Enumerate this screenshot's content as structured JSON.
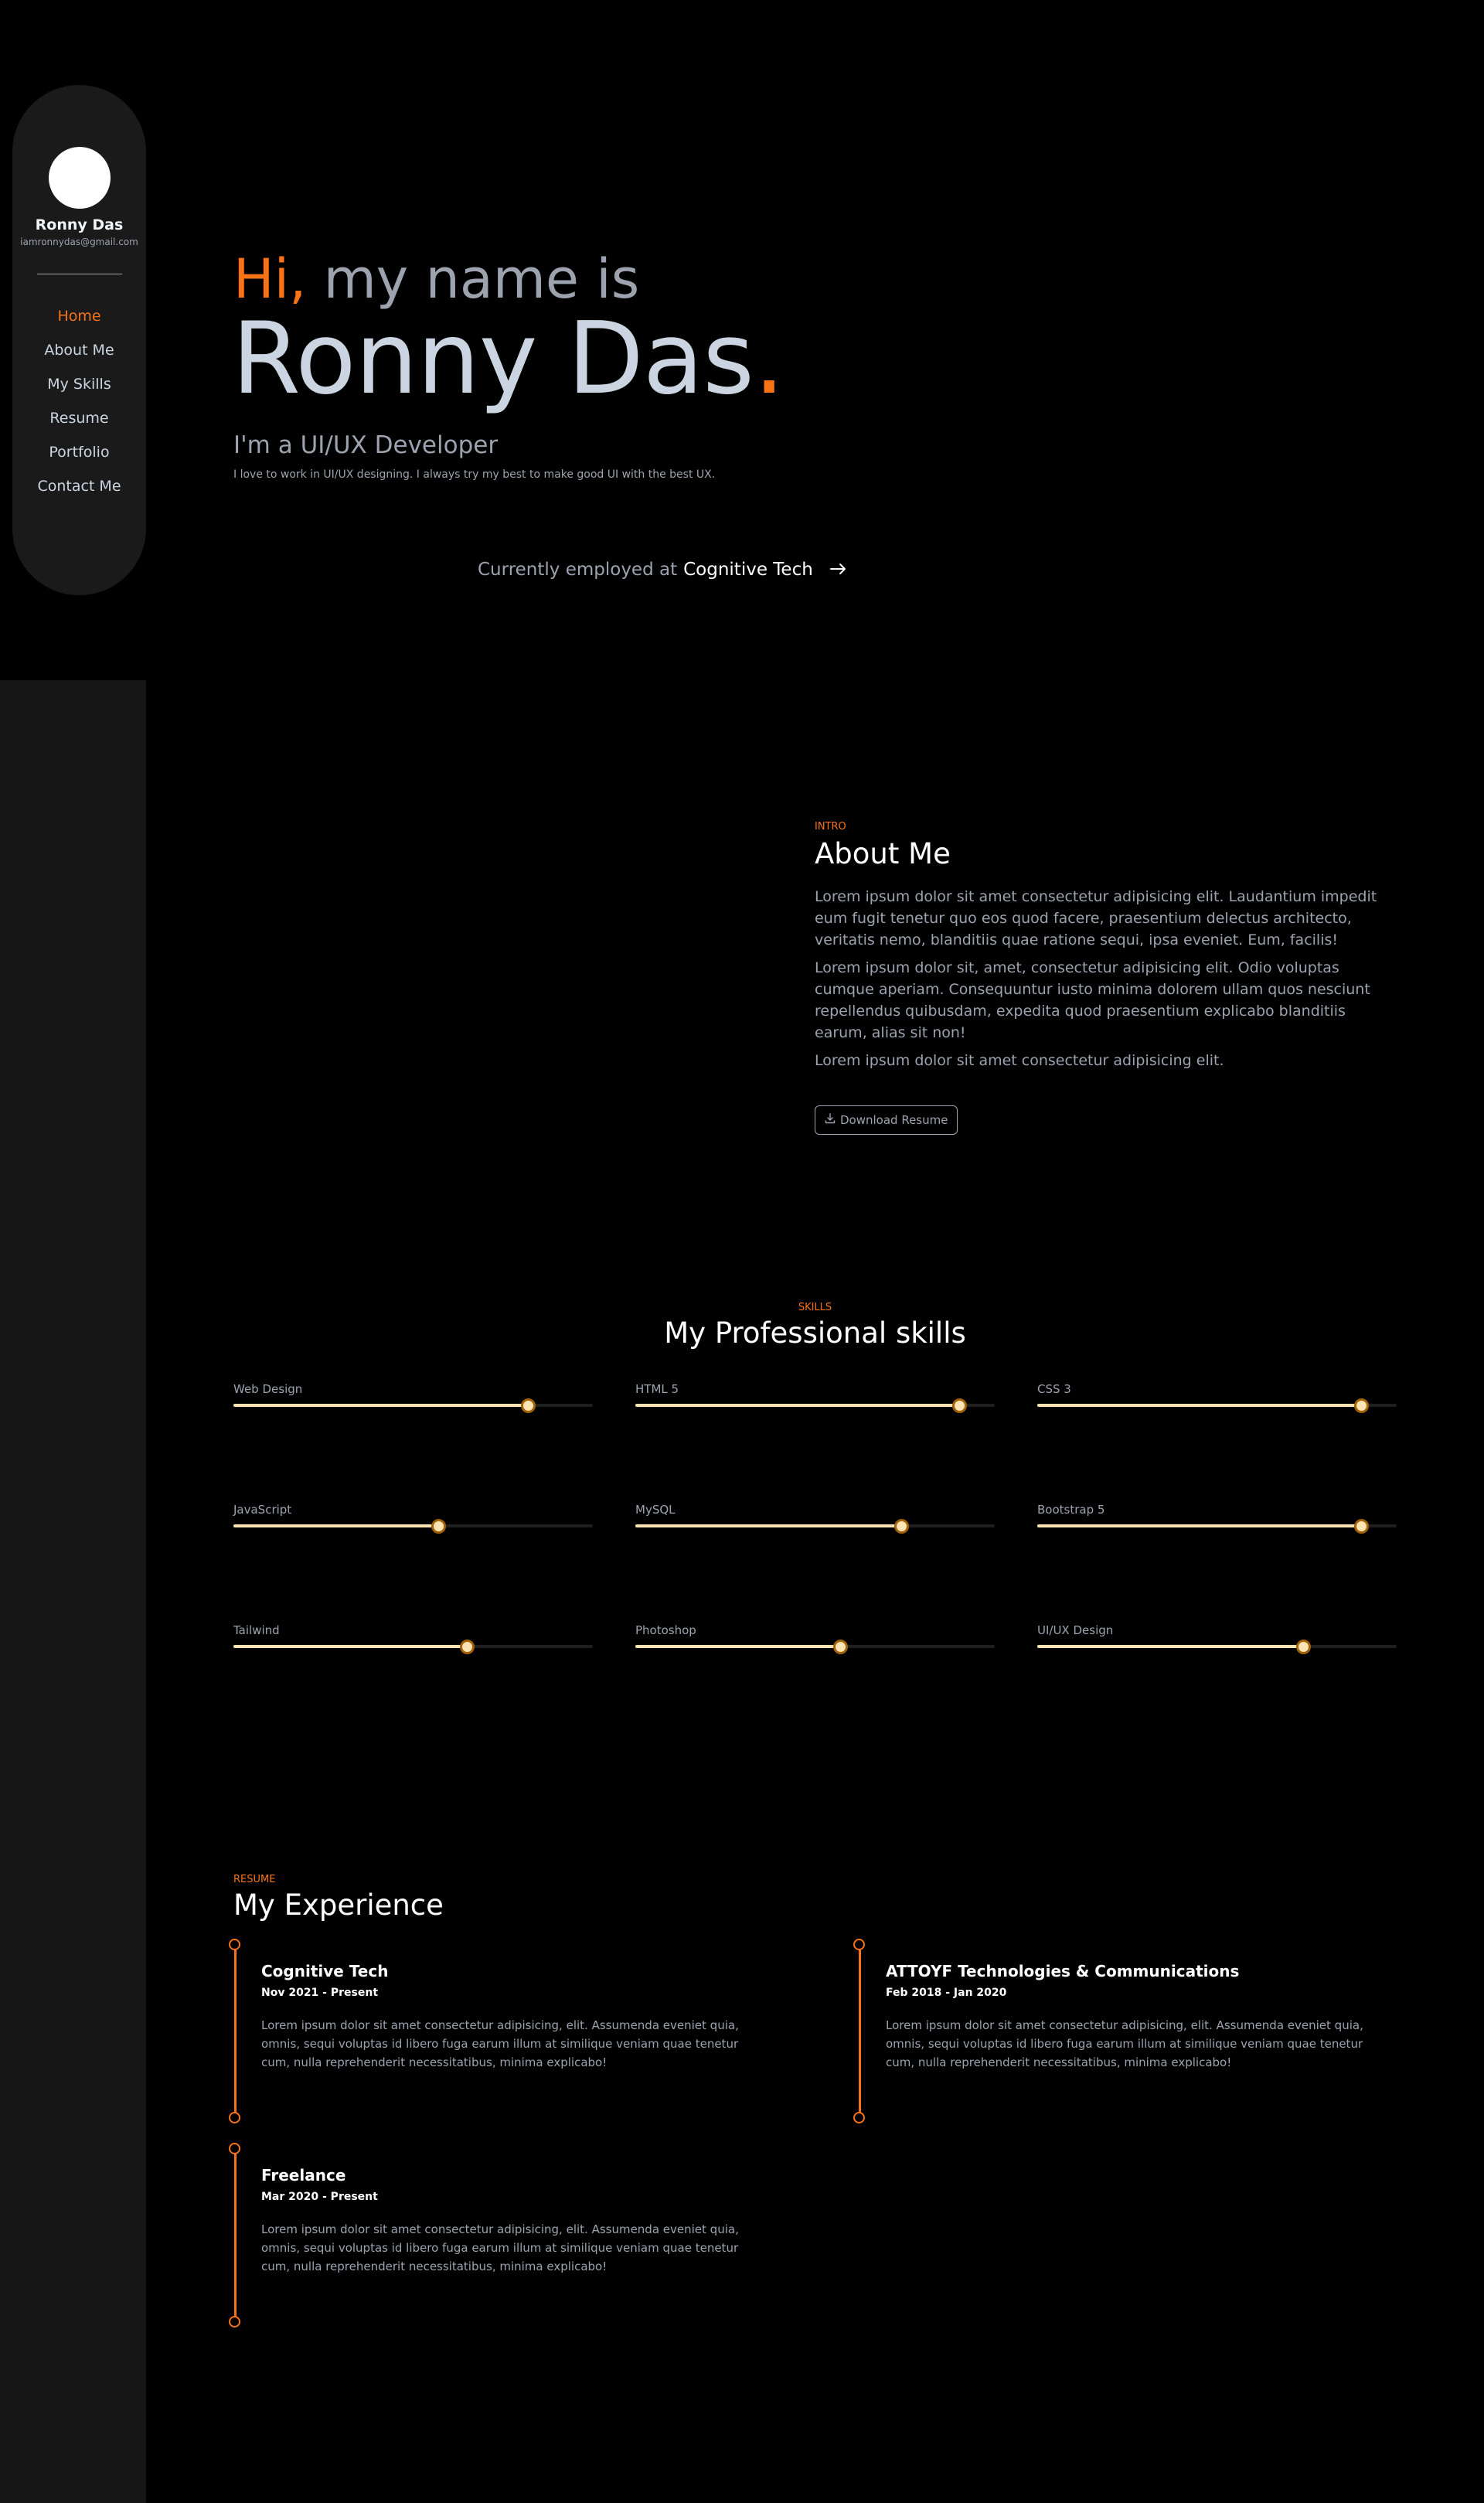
{
  "sidebar": {
    "name": "Ronny Das",
    "email": "iamronnydas@gmail.com",
    "nav": [
      {
        "label": "Home",
        "active": true
      },
      {
        "label": "About Me",
        "active": false
      },
      {
        "label": "My Skills",
        "active": false
      },
      {
        "label": "Resume",
        "active": false
      },
      {
        "label": "Portfolio",
        "active": false
      },
      {
        "label": "Contact Me",
        "active": false
      }
    ]
  },
  "hero": {
    "hi": "Hi,",
    "greeting_rest": "my name is",
    "name": "Ronny Das",
    "name_dot": ".",
    "role": "I'm a UI/UX Developer",
    "description": "I love to work in UI/UX designing. I always try my best to make good UI with the best UX.",
    "employed_prefix": "Currently employed at",
    "employed_company": "Cognitive Tech",
    "arrow_icon": "arrow-right-icon"
  },
  "about": {
    "tag": "INTRO",
    "title": "About Me",
    "paragraphs": [
      "Lorem ipsum dolor sit amet consectetur adipisicing elit. Laudantium impedit eum fugit tenetur quo eos quod facere, praesentium delectus architecto, veritatis nemo, blanditiis quae ratione sequi, ipsa eveniet. Eum, facilis!",
      "Lorem ipsum dolor sit, amet, consectetur adipisicing elit. Odio voluptas cumque aperiam. Consequuntur iusto minima dolorem ullam quos nesciunt repellendus quibusdam, expedita quod praesentium explicabo blanditiis earum, alias sit non!",
      "Lorem ipsum dolor sit amet consectetur adipisicing elit."
    ],
    "download_label": "Download Resume",
    "download_icon": "download-icon"
  },
  "skills": {
    "tag": "SKILLS",
    "title": "My Professional skills",
    "items": [
      {
        "label": "Web Design",
        "level": 0.82
      },
      {
        "label": "HTML 5",
        "level": 0.9
      },
      {
        "label": "CSS 3",
        "level": 0.9
      },
      {
        "label": "JavaScript",
        "level": 0.57
      },
      {
        "label": "MySQL",
        "level": 0.74
      },
      {
        "label": "Bootstrap 5",
        "level": 0.9
      },
      {
        "label": "Tailwind",
        "level": 0.65
      },
      {
        "label": "Photoshop",
        "level": 0.57
      },
      {
        "label": "UI/UX Design",
        "level": 0.74
      }
    ]
  },
  "experience": {
    "tag": "RESUME",
    "title": "My Experience",
    "items": [
      {
        "title": "Cognitive Tech",
        "dates": "Nov 2021 - Present",
        "text": "Lorem ipsum dolor sit amet consectetur adipisicing, elit. Assumenda eveniet quia, omnis, sequi voluptas id libero fuga earum illum at similique veniam quae tenetur cum, nulla reprehenderit necessitatibus, minima explicabo!"
      },
      {
        "title": "ATTOYF Technologies & Communications",
        "dates": "Feb 2018 - Jan 2020",
        "text": "Lorem ipsum dolor sit amet consectetur adipisicing, elit. Assumenda eveniet quia, omnis, sequi voluptas id libero fuga earum illum at similique veniam quae tenetur cum, nulla reprehenderit necessitatibus, minima explicabo!"
      },
      {
        "title": "Freelance",
        "dates": "Mar 2020 - Present",
        "text": "Lorem ipsum dolor sit amet consectetur adipisicing, elit. Assumenda eveniet quia, omnis, sequi voluptas id libero fuga earum illum at similique veniam quae tenetur cum, nulla reprehenderit necessitatibus, minima explicabo!"
      }
    ]
  },
  "colors": {
    "accent": "#f97316",
    "background": "#000000",
    "sidebar": "#1a1a1a",
    "skill_fill": "#fde4b5"
  }
}
